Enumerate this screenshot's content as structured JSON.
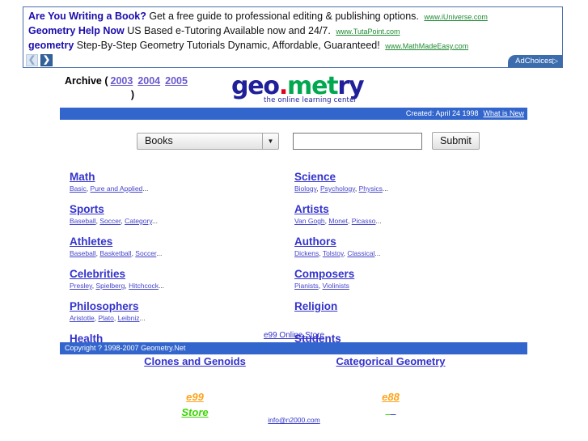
{
  "ads": {
    "rows": [
      {
        "title": "Are You Writing a Book?",
        "text": "Get a free guide to professional editing & publishing options.",
        "url": "www.iUniverse.com"
      },
      {
        "title": "Geometry Help Now",
        "text": "US Based e-Tutoring Available now and 24/7.",
        "url": "www.TutaPoint.com"
      },
      {
        "title": "geometry",
        "text": "Step-By-Step Geometry Tutorials Dynamic, Affordable, Guaranteed!",
        "url": "www.MathMadeEasy.com"
      }
    ],
    "prev_glyph": "❮",
    "next_glyph": "❯",
    "adchoices_label": "AdChoices",
    "adchoices_glyph": "▷"
  },
  "archive": {
    "label": "Archive (",
    "years": [
      "2003",
      "2004",
      "2005"
    ],
    "close": ")"
  },
  "logo": {
    "part1": "geo",
    "dot": ".",
    "part2": "met",
    "part3": "ry",
    "tagline": "the online learning center",
    "color_blue": "#20209a",
    "color_green": "#00a84f",
    "color_red": "#e2001a"
  },
  "topbar": {
    "created": "Created: April 24 1998",
    "whats_new": "What is New"
  },
  "search": {
    "selected_option": "Books",
    "options": [
      "Books"
    ],
    "query": "",
    "placeholder": "",
    "submit_label": "Submit",
    "arrow_glyph": "▼"
  },
  "categories": {
    "left": [
      {
        "title": "Math",
        "subs": [
          "Basic",
          "Pure and Applied"
        ],
        "ellipsis": "..."
      },
      {
        "title": "Sports",
        "subs": [
          "Baseball",
          "Soccer",
          "Category"
        ],
        "ellipsis": "..."
      },
      {
        "title": "Athletes",
        "subs": [
          "Baseball",
          "Basketball",
          "Soccer"
        ],
        "ellipsis": "..."
      },
      {
        "title": "Celebrities",
        "subs": [
          "Presley",
          "Spielberg",
          "Hitchcock"
        ],
        "ellipsis": "..."
      },
      {
        "title": "Philosophers",
        "subs": [
          "Aristotle",
          "Plato",
          "Leibniz"
        ],
        "ellipsis": "..."
      },
      {
        "title": "Health",
        "subs": [],
        "ellipsis": ""
      }
    ],
    "right": [
      {
        "title": "Science",
        "subs": [
          "Biology",
          "Psychology",
          "Physics"
        ],
        "ellipsis": "..."
      },
      {
        "title": "Artists",
        "subs": [
          "Van Gogh",
          "Monet",
          "Picasso"
        ],
        "ellipsis": "..."
      },
      {
        "title": "Authors",
        "subs": [
          "Dickens",
          "Tolstoy",
          "Classical"
        ],
        "ellipsis": "..."
      },
      {
        "title": "Composers",
        "subs": [
          "Pianists",
          "Violinists"
        ],
        "ellipsis": ""
      },
      {
        "title": "Religion",
        "subs": [],
        "ellipsis": ""
      },
      {
        "title": "Students",
        "subs": [],
        "ellipsis": ""
      }
    ]
  },
  "footer": {
    "store_link": "e99 Online Store",
    "copyright": "Copyright ? 1998-2007 Geometry.Net",
    "left_heading": "Clones and Genoids",
    "right_heading": "Categorical Geometry",
    "left_sub_1": "e99",
    "left_sub_2": "Store",
    "right_sub_1": "e88",
    "right_tiny_1": "_",
    "right_tiny_2": "_",
    "email": "info@n2000.com",
    "orange": "#ffa31a",
    "green": "#3bd400"
  }
}
